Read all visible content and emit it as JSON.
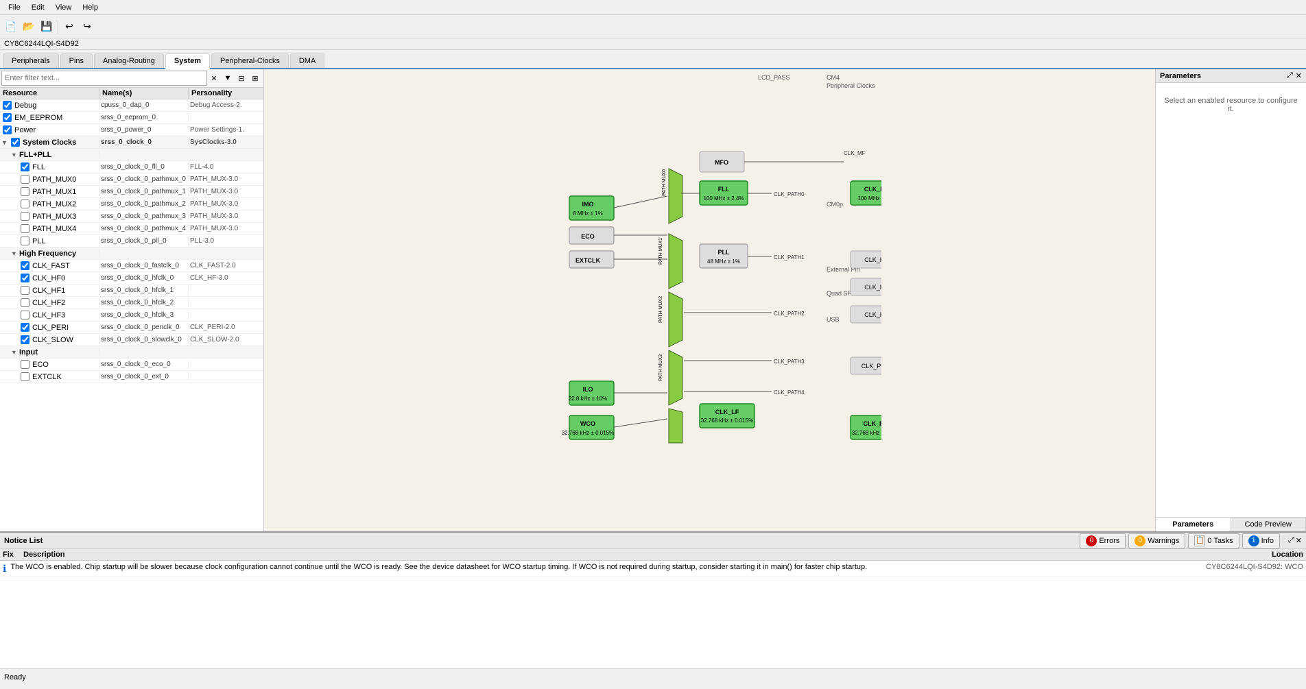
{
  "app": {
    "title": "CY8C6244LQI-S4D92",
    "status": "Ready"
  },
  "menu": {
    "items": [
      "File",
      "Edit",
      "View",
      "Help"
    ]
  },
  "toolbar": {
    "buttons": [
      "new",
      "open",
      "save",
      "undo",
      "redo"
    ]
  },
  "tabs": [
    {
      "label": "Peripherals",
      "active": false
    },
    {
      "label": "Pins",
      "active": false
    },
    {
      "label": "Analog-Routing",
      "active": false
    },
    {
      "label": "System",
      "active": true
    },
    {
      "label": "Peripheral-Clocks",
      "active": false
    },
    {
      "label": "DMA",
      "active": false
    }
  ],
  "filter": {
    "placeholder": "Enter filter text..."
  },
  "table": {
    "headers": [
      "Resource",
      "Name(s)",
      "Personality"
    ],
    "rows": [
      {
        "indent": 0,
        "type": "check",
        "checked": true,
        "label": "Debug",
        "name": "cpuss_0_dap_0",
        "personality": "Debug Access-2.",
        "enabled": true
      },
      {
        "indent": 0,
        "type": "check",
        "checked": true,
        "label": "EM_EEPROM",
        "name": "srss_0_eeprom_0",
        "personality": "",
        "enabled": true
      },
      {
        "indent": 0,
        "type": "check",
        "checked": true,
        "label": "Power",
        "name": "srss_0_power_0",
        "personality": "Power Settings-1.",
        "enabled": true
      },
      {
        "indent": 0,
        "type": "group",
        "expand": true,
        "label": "System Clocks",
        "name": "srss_0_clock_0",
        "personality": "SysClocks-3.0"
      },
      {
        "indent": 1,
        "type": "group",
        "expand": true,
        "label": "FLL+PLL",
        "name": "",
        "personality": ""
      },
      {
        "indent": 2,
        "type": "check",
        "checked": true,
        "label": "FLL",
        "name": "srss_0_clock_0_fll_0",
        "personality": "FLL-4.0"
      },
      {
        "indent": 2,
        "type": "check",
        "checked": false,
        "label": "PATH_MUX0",
        "name": "srss_0_clock_0_pathmux_0",
        "personality": "PATH_MUX-3.0"
      },
      {
        "indent": 2,
        "type": "check",
        "checked": false,
        "label": "PATH_MUX1",
        "name": "srss_0_clock_0_pathmux_1",
        "personality": "PATH_MUX-3.0"
      },
      {
        "indent": 2,
        "type": "check",
        "checked": false,
        "label": "PATH_MUX2",
        "name": "srss_0_clock_0_pathmux_2",
        "personality": "PATH_MUX-3.0"
      },
      {
        "indent": 2,
        "type": "check",
        "checked": false,
        "label": "PATH_MUX3",
        "name": "srss_0_clock_0_pathmux_3",
        "personality": "PATH_MUX-3.0"
      },
      {
        "indent": 2,
        "type": "check",
        "checked": false,
        "label": "PATH_MUX4",
        "name": "srss_0_clock_0_pathmux_4",
        "personality": "PATH_MUX-3.0"
      },
      {
        "indent": 2,
        "type": "check",
        "checked": false,
        "label": "PLL",
        "name": "srss_0_clock_0_pll_0",
        "personality": "PLL-3.0"
      },
      {
        "indent": 1,
        "type": "group",
        "expand": true,
        "label": "High Frequency",
        "name": "",
        "personality": ""
      },
      {
        "indent": 2,
        "type": "check",
        "checked": true,
        "label": "CLK_FAST",
        "name": "srss_0_clock_0_fastclk_0",
        "personality": "CLK_FAST-2.0"
      },
      {
        "indent": 2,
        "type": "check",
        "checked": true,
        "label": "CLK_HF0",
        "name": "srss_0_clock_0_hfclk_0",
        "personality": "CLK_HF-3.0"
      },
      {
        "indent": 2,
        "type": "check",
        "checked": false,
        "label": "CLK_HF1",
        "name": "srss_0_clock_0_hfclk_1",
        "personality": ""
      },
      {
        "indent": 2,
        "type": "check",
        "checked": false,
        "label": "CLK_HF2",
        "name": "srss_0_clock_0_hfclk_2",
        "personality": ""
      },
      {
        "indent": 2,
        "type": "check",
        "checked": false,
        "label": "CLK_HF3",
        "name": "srss_0_clock_0_hfclk_3",
        "personality": ""
      },
      {
        "indent": 2,
        "type": "check",
        "checked": true,
        "label": "CLK_PERI",
        "name": "srss_0_clock_0_periclk_0",
        "personality": "CLK_PERI-2.0"
      },
      {
        "indent": 2,
        "type": "check",
        "checked": true,
        "label": "CLK_SLOW",
        "name": "srss_0_clock_0_slowclk_0",
        "personality": "CLK_SLOW-2.0"
      },
      {
        "indent": 1,
        "type": "group",
        "expand": true,
        "label": "Input",
        "name": "",
        "personality": ""
      },
      {
        "indent": 2,
        "type": "check",
        "checked": false,
        "label": "ECO",
        "name": "srss_0_clock_0_eco_0",
        "personality": ""
      },
      {
        "indent": 2,
        "type": "check",
        "checked": false,
        "label": "EXTCLK",
        "name": "srss_0_clock_0_ext_0",
        "personality": ""
      }
    ]
  },
  "right_panel": {
    "title": "Parameters",
    "message": "Select an enabled resource to configure it.",
    "tabs": [
      "Parameters",
      "Code Preview"
    ]
  },
  "notice": {
    "title": "Notice List",
    "buttons": [
      {
        "icon": "error",
        "count": "0",
        "label": "Errors"
      },
      {
        "icon": "warning",
        "count": "0",
        "label": "Warnings"
      },
      {
        "icon": "task",
        "count": "0",
        "label": "Tasks"
      },
      {
        "icon": "info",
        "count": "1",
        "label": "Info"
      }
    ],
    "columns": [
      "Fix",
      "Description",
      "Location"
    ],
    "rows": [
      {
        "icon": "info",
        "description": "The WCO is enabled. Chip startup will be slower because clock configuration cannot continue until the WCO is ready. See the device datasheet for WCO startup timing. If WCO is not required during startup, consider starting it in main() for faster chip startup.",
        "location": "CY8C6244LQI-S4D92: WCO"
      }
    ]
  }
}
